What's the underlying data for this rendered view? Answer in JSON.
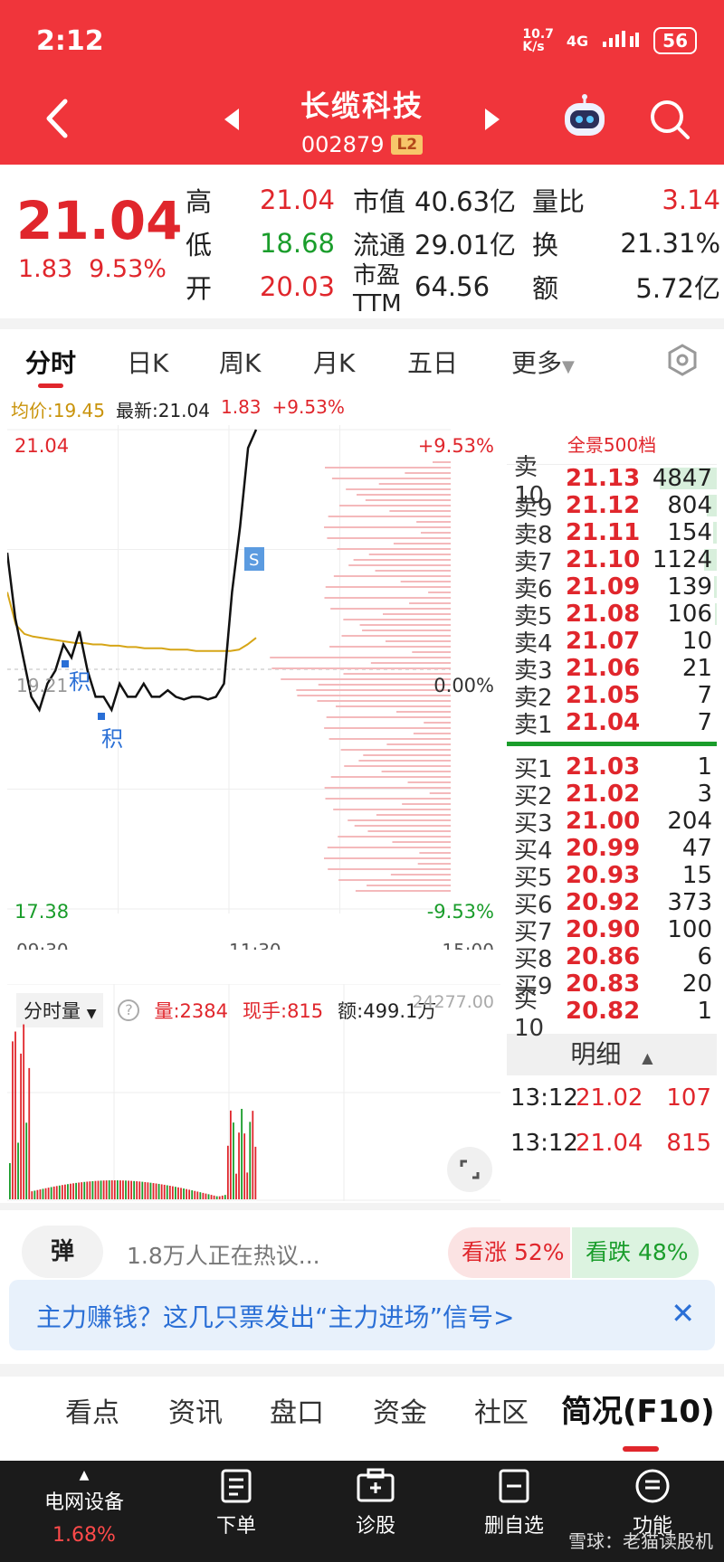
{
  "status": {
    "time": "2:12",
    "net_speed": "10.7\nK/s",
    "net": "4G",
    "battery": "56"
  },
  "header": {
    "title": "长缆科技",
    "code": "002879",
    "badge": "L2"
  },
  "quote": {
    "price": "21.04",
    "change": "1.83",
    "change_pct": "9.53%",
    "rows": [
      {
        "l1": "高",
        "v1": "21.04",
        "l2": "市值",
        "v2": "40.63亿",
        "l3": "量比",
        "v3": "3.14"
      },
      {
        "l1": "低",
        "v1": "18.68",
        "l2": "流通",
        "v2": "29.01亿",
        "l3": "换",
        "v3": "21.31%"
      },
      {
        "l1": "开",
        "v1": "20.03",
        "l2": "市盈TTM",
        "v2": "64.56",
        "l3": "额",
        "v3": "5.72亿"
      }
    ]
  },
  "tabs": [
    "分时",
    "日K",
    "周K",
    "月K",
    "五日",
    "更多"
  ],
  "info": {
    "avg": "均价:19.45",
    "latest": "最新:21.04",
    "chg": "1.83",
    "pct": "+9.53%"
  },
  "chart": {
    "top_left": "21.04",
    "bottom_left": "17.38",
    "top_right": "+9.53%",
    "mid_right": "0.00%",
    "bottom_right": "-9.53%",
    "mid_left": "19.21",
    "t_start": "09:30",
    "t_mid": "11:30",
    "t_end": "15:00",
    "mark_ji": "积",
    "mark_s": "S",
    "price_series": [
      20.1,
      19.6,
      19.3,
      19.0,
      18.9,
      19.1,
      19.2,
      19.4,
      19.3,
      19.5,
      19.2,
      19.0,
      19.0,
      18.9,
      19.1,
      19.0,
      19.0,
      19.1,
      19.0,
      19.0,
      19.05,
      19.0,
      18.98,
      19.0,
      19.0,
      18.98,
      19.0,
      19.1,
      19.8,
      20.3,
      20.9,
      21.04
    ],
    "avg_series": [
      19.8,
      19.55,
      19.48,
      19.46,
      19.45,
      19.44,
      19.43,
      19.42,
      19.41,
      19.41,
      19.4,
      19.4,
      19.39,
      19.39,
      19.38,
      19.38,
      19.37,
      19.37,
      19.37,
      19.36,
      19.36,
      19.36,
      19.35,
      19.35,
      19.35,
      19.35,
      19.35,
      19.36,
      19.4,
      19.45
    ]
  },
  "orderbook": {
    "title": "全景500档",
    "asks": [
      {
        "lvl": "卖10",
        "px": "21.13",
        "vol": "4847",
        "bar": 0.9
      },
      {
        "lvl": "卖9",
        "px": "21.12",
        "vol": "804",
        "bar": 0.15
      },
      {
        "lvl": "卖8",
        "px": "21.11",
        "vol": "154",
        "bar": 0.05
      },
      {
        "lvl": "卖7",
        "px": "21.10",
        "vol": "1124",
        "bar": 0.2
      },
      {
        "lvl": "卖6",
        "px": "21.09",
        "vol": "139",
        "bar": 0.04
      },
      {
        "lvl": "卖5",
        "px": "21.08",
        "vol": "106",
        "bar": 0.03
      },
      {
        "lvl": "卖4",
        "px": "21.07",
        "vol": "10",
        "bar": 0.0
      },
      {
        "lvl": "卖3",
        "px": "21.06",
        "vol": "21",
        "bar": 0.0
      },
      {
        "lvl": "卖2",
        "px": "21.05",
        "vol": "7",
        "bar": 0.0
      },
      {
        "lvl": "卖1",
        "px": "21.04",
        "vol": "7",
        "bar": 0.0
      }
    ],
    "bids": [
      {
        "lvl": "买1",
        "px": "21.03",
        "vol": "1"
      },
      {
        "lvl": "买2",
        "px": "21.02",
        "vol": "3"
      },
      {
        "lvl": "买3",
        "px": "21.00",
        "vol": "204"
      },
      {
        "lvl": "买4",
        "px": "20.99",
        "vol": "47"
      },
      {
        "lvl": "买5",
        "px": "20.93",
        "vol": "15"
      },
      {
        "lvl": "买6",
        "px": "20.92",
        "vol": "373"
      },
      {
        "lvl": "买7",
        "px": "20.90",
        "vol": "100"
      },
      {
        "lvl": "买8",
        "px": "20.86",
        "vol": "6"
      },
      {
        "lvl": "买9",
        "px": "20.83",
        "vol": "20"
      },
      {
        "lvl": "买10",
        "px": "20.82",
        "vol": "1"
      }
    ],
    "detail_title": "明细",
    "details": [
      {
        "t": "13:12",
        "p": "21.02",
        "v": "107"
      },
      {
        "t": "13:12",
        "p": "21.04",
        "v": "815"
      }
    ]
  },
  "volume": {
    "selector": "分时量",
    "qty": "量:2384",
    "now": "现手:815",
    "amt": "额:499.1万",
    "top_value": "24277.00"
  },
  "discussion": {
    "btn": "弹",
    "text": "1.8万人正在热议...",
    "up": "看涨 52%",
    "down": "看跌 48%",
    "up_share": 0.52
  },
  "banner": {
    "text": "主力赚钱？这几只票发出“主力进场”信号>"
  },
  "bottom_tabs": [
    "看点",
    "资讯",
    "盘口",
    "资金",
    "社区",
    "简况(F10)"
  ],
  "bottom_bar": {
    "sector": "电网设备",
    "sector_pct": "1.68%",
    "b1": "下单",
    "b2": "诊股",
    "b3": "删自选",
    "b4": "功能",
    "watermark": "雪球：老猫读股机"
  }
}
